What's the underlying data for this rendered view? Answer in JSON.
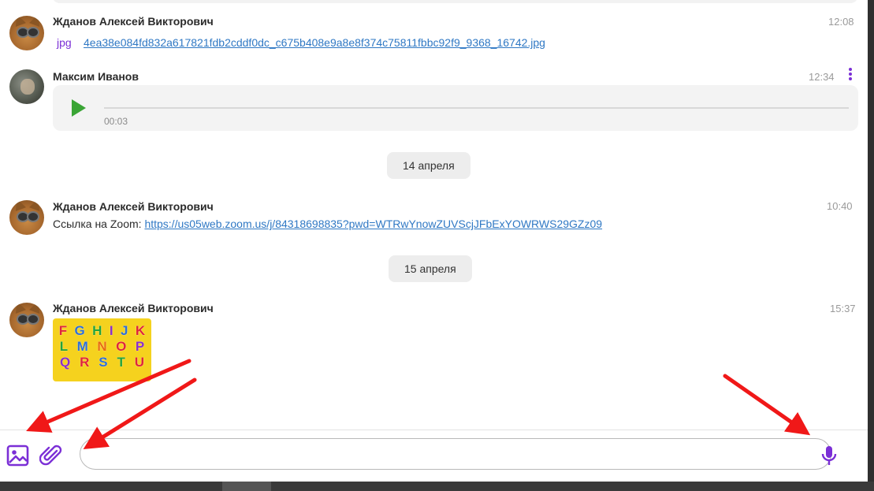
{
  "messages": [
    {
      "author": "Жданов Алексей Викторович",
      "time": "12:08",
      "file_type": "jpg",
      "file_name": "4ea38e084fd832a617821fdb2cddf0dc_c675b408e9a8e8f374c75811fbbc92f9_9368_16742.jpg"
    },
    {
      "author": "Максим Иванов",
      "time": "12:34",
      "audio_duration": "00:03"
    },
    {
      "author": "Жданов Алексей Викторович",
      "time": "10:40",
      "text_prefix": "Ссылка на Zoom: ",
      "link": "https://us05web.zoom.us/j/84318698835?pwd=WTRwYnowZUVScjJFbExYOWRWS29GZz09"
    },
    {
      "author": "Жданов Алексей Викторович",
      "time": "15:37",
      "image_letters": [
        [
          "F",
          "G",
          "H",
          "I",
          "J",
          "K"
        ],
        [
          "L",
          "M",
          "N",
          "O",
          "P"
        ],
        [
          "Q",
          "R",
          "S",
          "T",
          "U"
        ]
      ]
    }
  ],
  "date_dividers": [
    "14 апреля",
    "15 апреля"
  ],
  "composer": {
    "input_value": "",
    "image_icon": "image-icon",
    "attach_icon": "paperclip-icon",
    "mic_icon": "microphone-icon"
  },
  "colors": {
    "accent": "#7b2fd6",
    "link": "#2f78c4",
    "play": "#3aa535",
    "annotation_arrow": "#f01818"
  }
}
